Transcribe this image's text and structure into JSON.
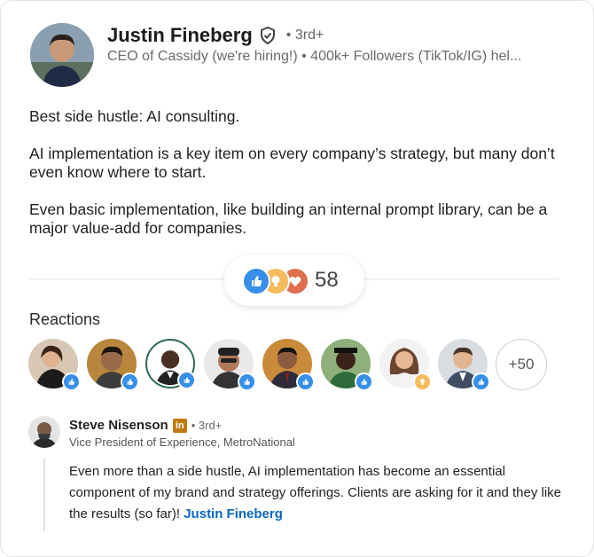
{
  "post": {
    "author": {
      "name": "Justin Fineberg",
      "degree": "• 3rd+",
      "headline": "CEO of Cassidy (we're hiring!) • 400k+ Followers (TikTok/IG) hel..."
    },
    "paragraphs": [
      "Best side hustle: AI consulting.",
      "AI implementation is a key item on every company’s strategy, but many don’t even know where to start.",
      "Even basic implementation, like building an internal prompt library, can be a major value-add for companies."
    ],
    "reactions": {
      "count": "58",
      "icons": [
        "like-icon",
        "insightful-icon",
        "love-icon"
      ]
    }
  },
  "reactions_section": {
    "title": "Reactions",
    "more_label": "+50",
    "people": [
      {
        "badge": "like"
      },
      {
        "badge": "like"
      },
      {
        "badge": "like"
      },
      {
        "badge": "like"
      },
      {
        "badge": "like"
      },
      {
        "badge": "like"
      },
      {
        "badge": "insightful"
      },
      {
        "badge": "like"
      }
    ]
  },
  "comment": {
    "name": "Steve Nisenson",
    "badge": "in",
    "degree": "• 3rd+",
    "title": "Vice President of Experience, MetroNational",
    "text": "Even more than a side hustle, AI implementation has become an essential component of my brand and strategy offerings. Clients are asking for it and they like the results (so far)! ",
    "mention": "Justin Fineberg"
  },
  "colors": {
    "like": "#378fe9",
    "insightful": "#f5bb5c",
    "love": "#df704d",
    "link": "#0a66c2"
  }
}
